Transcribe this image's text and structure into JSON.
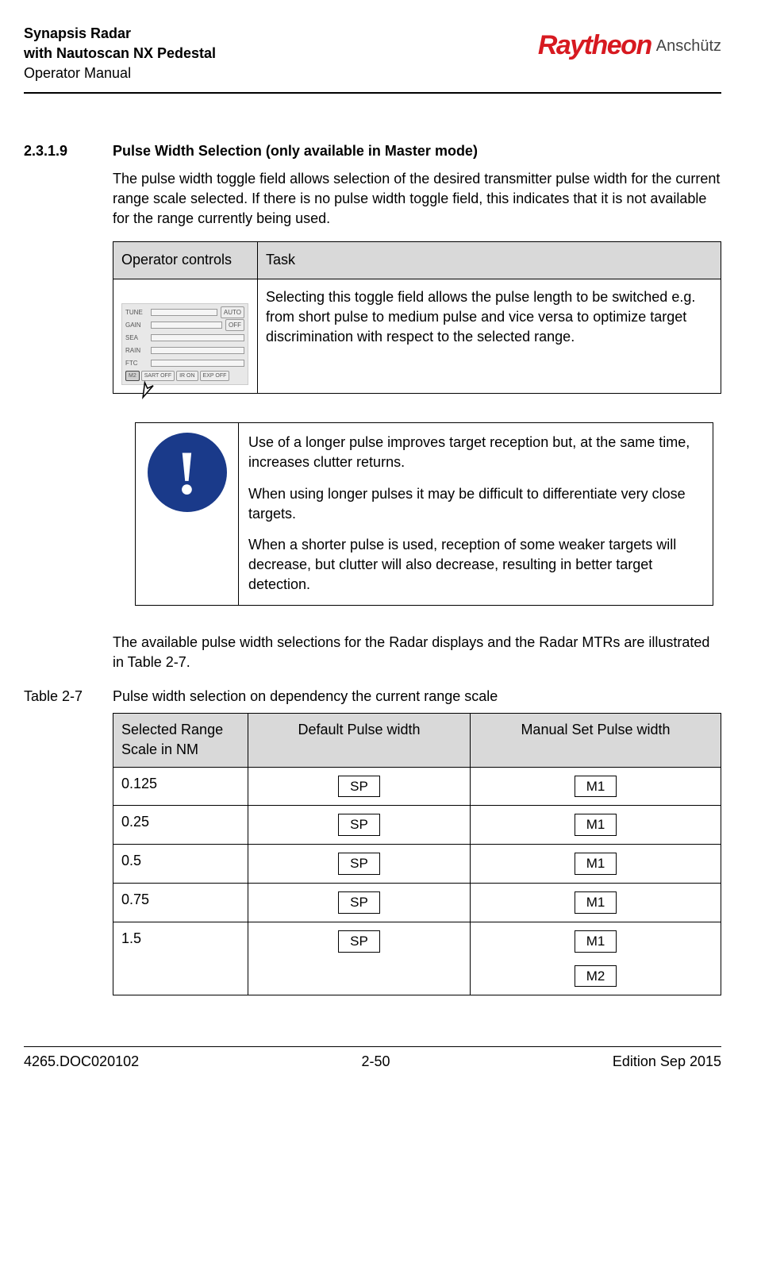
{
  "header": {
    "title1": "Synapsis Radar",
    "title2": "with Nautoscan NX Pedestal",
    "sub": "Operator Manual",
    "logo_main": "Raytheon",
    "logo_sub": "Anschütz"
  },
  "section": {
    "num": "2.3.1.9",
    "title": "Pulse Width Selection (only available in Master mode)",
    "intro": "The pulse width toggle field allows selection of the desired transmitter pulse width for the current range scale selected. If there is no pulse width toggle field, this indicates that it is not available for the range currently being used."
  },
  "table1": {
    "col1": "Operator controls",
    "col2": "Task",
    "task": "Selecting this toggle field allows the pulse length to be switched e.g. from short pulse to medium pulse and vice versa to optimize target discrimination with respect to the selected range.",
    "panel": {
      "tune": "TUNE",
      "auto": "AUTO",
      "gain": "GAIN",
      "off": "OFF",
      "sea": "SEA",
      "rain": "RAIN",
      "ftc": "FTC",
      "m2": "M2",
      "sart": "SART OFF",
      "ir": "IR ON",
      "exp": "EXP OFF"
    }
  },
  "note": {
    "p1": "Use of a longer pulse improves target reception but, at the same time, increases clutter returns.",
    "p2": "When using longer pulses it may be difficult to differentiate very close targets.",
    "p3": "When a shorter pulse is used, reception of some weaker targets will decrease, but clutter will also decrease, resulting in better target detection."
  },
  "after_note": "The available pulse width selections for the Radar displays and the Radar MTRs are illustrated in Table 2-7.",
  "table2_label": {
    "num": "Table 2-7",
    "txt": "Pulse width selection on dependency the current range scale"
  },
  "table2": {
    "h1": "Selected Range Scale in NM",
    "h2": "Default Pulse width",
    "h3": "Manual Set Pulse width",
    "rows": [
      {
        "range": "0.125",
        "default": [
          "SP"
        ],
        "manual": [
          "M1"
        ]
      },
      {
        "range": "0.25",
        "default": [
          "SP"
        ],
        "manual": [
          "M1"
        ]
      },
      {
        "range": "0.5",
        "default": [
          "SP"
        ],
        "manual": [
          "M1"
        ]
      },
      {
        "range": "0.75",
        "default": [
          "SP"
        ],
        "manual": [
          "M1"
        ]
      },
      {
        "range": "1.5",
        "default": [
          "SP"
        ],
        "manual": [
          "M1",
          "M2"
        ]
      }
    ]
  },
  "footer": {
    "docnum": "4265.DOC020102",
    "page": "2-50",
    "edition": "Edition Sep 2015"
  }
}
